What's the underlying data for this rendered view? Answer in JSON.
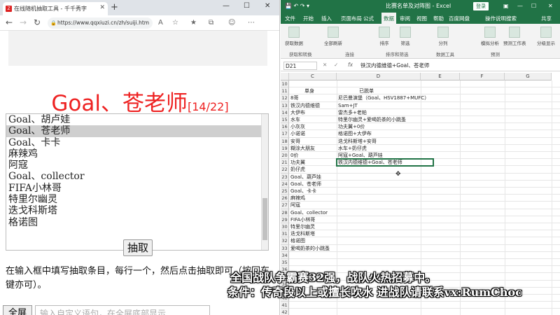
{
  "browser": {
    "tab_title": "在线随机抽取工具 - 千千秀字",
    "url": "https://www.qqxiuzi.cn/zh/suiji.htm",
    "result": "Goal、苍老师",
    "counter": "[14/22]",
    "list_items": [
      "Goal、胡卢娃",
      "Goal、苍老师",
      "Goal、卡卡",
      "麻辣鸡",
      "阿寇",
      "Goal、collector",
      "FIFA小林哥",
      "特里尔幽灵",
      "迭戈科斯塔",
      "格诺图"
    ],
    "draw_button": "抽取",
    "instructions": "在输入框中填写抽取条目，每行一个，然后点击抽取即可（按回车键亦可）。",
    "fullscreen_button": "全屏",
    "custom_placeholder": "输入自定义语句，在全屏底部显示"
  },
  "excel": {
    "doc_title": "比赛名单及对阵图 - Excel",
    "login_button": "登录",
    "share": "共享",
    "menu": [
      "文件",
      "开始",
      "插入",
      "页面布局",
      "公式",
      "数据",
      "审阅",
      "视图",
      "帮助",
      "百度网盘",
      "操作说明搜索"
    ],
    "active_menu": "数据",
    "ribbon_groups": [
      {
        "label": "获取数据"
      },
      {
        "label": "全部刷新"
      },
      {
        "label": "排序"
      },
      {
        "label": "筛选"
      },
      {
        "label": "分列"
      },
      {
        "label": "模拟分析"
      },
      {
        "label": "预测工作表"
      },
      {
        "label": "分级显示"
      }
    ],
    "ribbon_labels": [
      "获取和转换",
      "连接",
      "排序和筛选",
      "数据工具",
      "预测"
    ],
    "name_box": "D21",
    "fx": "fx",
    "formula": "铁汉内德维德+Goal、苍老师",
    "columns": [
      "C",
      "D",
      "E",
      "F",
      "G"
    ],
    "rows": [
      {
        "n": "10",
        "c": "",
        "d": ""
      },
      {
        "n": "11",
        "c": "单身",
        "d": "已脱单"
      },
      {
        "n": "12",
        "c": "8哥",
        "d": "尼巴曼演堡（Goal、HSV1887+MUFC）"
      },
      {
        "n": "13",
        "c": "铁汉内德维德",
        "d": "Sam+JT"
      },
      {
        "n": "14",
        "c": "大伊布",
        "d": "雷杰多+老帕"
      },
      {
        "n": "15",
        "c": "水车",
        "d": "特里尔幽灵+爱喝奶茶的小跳蚤"
      },
      {
        "n": "16",
        "c": "小灰灰",
        "d": "功夫翼+0价"
      },
      {
        "n": "17",
        "c": "小诺诺",
        "d": "格诺图+大伊布"
      },
      {
        "n": "18",
        "c": "安哥",
        "d": "迭戈科斯塔+安哥"
      },
      {
        "n": "19",
        "c": "糊涂大朋友",
        "d": "水车+奶仔虎"
      },
      {
        "n": "20",
        "c": "0价",
        "d": "阿寇+Goal、葫芦娃"
      },
      {
        "n": "21",
        "c": "功夫翼",
        "d": "铁汉内德维德+Goal、苍老师"
      },
      {
        "n": "22",
        "c": "奶仔虎",
        "d": ""
      },
      {
        "n": "23",
        "c": "Goal、葫芦娃",
        "d": ""
      },
      {
        "n": "24",
        "c": "Goal、苍老师",
        "d": ""
      },
      {
        "n": "25",
        "c": "Goal、卡卡",
        "d": ""
      },
      {
        "n": "26",
        "c": "麻辣鸡",
        "d": ""
      },
      {
        "n": "27",
        "c": "阿寇",
        "d": ""
      },
      {
        "n": "28",
        "c": "Goal、collector",
        "d": ""
      },
      {
        "n": "29",
        "c": "FIFA小林哥",
        "d": ""
      },
      {
        "n": "30",
        "c": "特里尔幽灵",
        "d": ""
      },
      {
        "n": "31",
        "c": "迭戈科斯塔",
        "d": ""
      },
      {
        "n": "32",
        "c": "格诺图",
        "d": ""
      },
      {
        "n": "33",
        "c": "爱喝奶茶的小跳蚤",
        "d": ""
      },
      {
        "n": "34",
        "c": "",
        "d": ""
      },
      {
        "n": "35",
        "c": "",
        "d": ""
      },
      {
        "n": "36",
        "c": "",
        "d": ""
      },
      {
        "n": "37",
        "c": "",
        "d": ""
      },
      {
        "n": "38",
        "c": "",
        "d": ""
      },
      {
        "n": "39",
        "c": "",
        "d": ""
      },
      {
        "n": "40",
        "c": "",
        "d": ""
      },
      {
        "n": "41",
        "c": "",
        "d": ""
      },
      {
        "n": "42",
        "c": "",
        "d": ""
      }
    ]
  },
  "overlay": {
    "line1": "全国战队争霸赛32强，战队火热招募中。",
    "line2": "条件：传奇段以上或擅长吹水  进战队请联系vx:RumChoc"
  },
  "colors": {
    "excel_green": "#217346",
    "result_red": "#e22222"
  }
}
